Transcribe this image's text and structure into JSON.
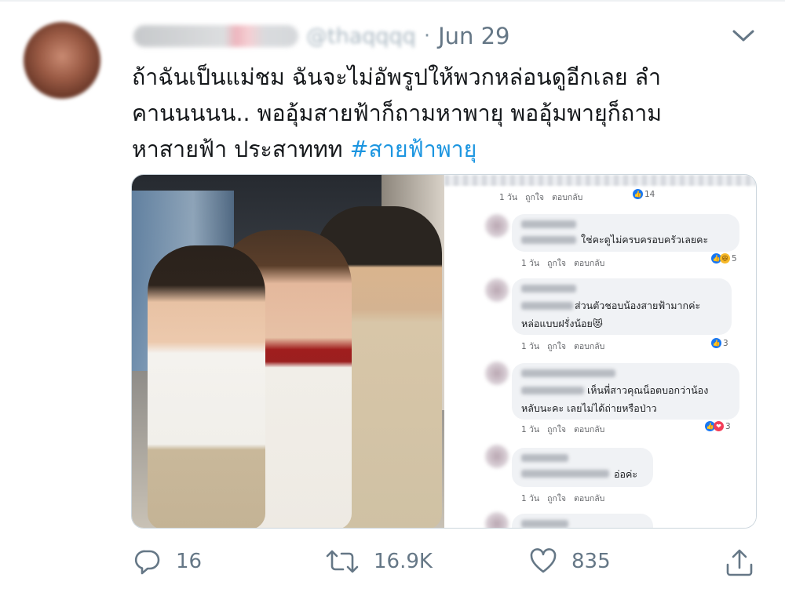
{
  "tweet": {
    "date": "Jun 29",
    "dot": "·",
    "handle": "@thaqqqq",
    "text_lines": [
      "ถ้าฉันเป็นแม่ชม ฉันจะไม่อัพรูปให้พวกหล่อนดูอีกเลย ลำ",
      "คานนนนน.. พออุ้มสายฟ้าก็ถามหาพายุ พออุ้มพายุก็ถาม",
      "หาสายฟ้า ประสาททท "
    ],
    "hashtag": "#สายฟ้าพายุ"
  },
  "comments": [
    {
      "text": "",
      "meta": {
        "time": "1 วัน",
        "like": "ถูกใจ",
        "reply": "ตอบกลับ"
      },
      "reactions": "14"
    },
    {
      "text": "ใช่คะดูไม่ครบครอบครัวเลยคะ",
      "meta": {
        "time": "1 วัน",
        "like": "ถูกใจ",
        "reply": "ตอบกลับ"
      },
      "reactions": "5"
    },
    {
      "text_1": "ส่วนตัวชอบน้องสายฟ้ามากค่ะ",
      "text_2": "หล่อแบบฝรั่งน้อย😻",
      "meta": {
        "time": "1 วัน",
        "like": "ถูกใจ",
        "reply": "ตอบกลับ"
      },
      "reactions": "3"
    },
    {
      "text_1": "เห็นพี่สาวคุณน็อตบอกว่าน้อง",
      "text_2": "หลับนะคะ เลยไม่ได้ถ่ายหรือป่าว",
      "meta": {
        "time": "1 วัน",
        "like": "ถูกใจ",
        "reply": "ตอบกลับ"
      },
      "reactions": "3"
    },
    {
      "text": "อ่อค่ะ",
      "meta": {
        "time": "1 วัน",
        "like": "ถูกใจ",
        "reply": "ตอบกลับ"
      }
    }
  ],
  "actions": {
    "reply_count": "16",
    "retweet_count": "16.9K",
    "like_count": "835"
  },
  "colors": {
    "text": "#14171a",
    "secondary": "#657786",
    "hashtag": "#1b95e0",
    "border": "#ccd6dd"
  },
  "icons": [
    "chevron-down-icon",
    "reply-icon",
    "retweet-icon",
    "heart-icon",
    "share-icon"
  ]
}
